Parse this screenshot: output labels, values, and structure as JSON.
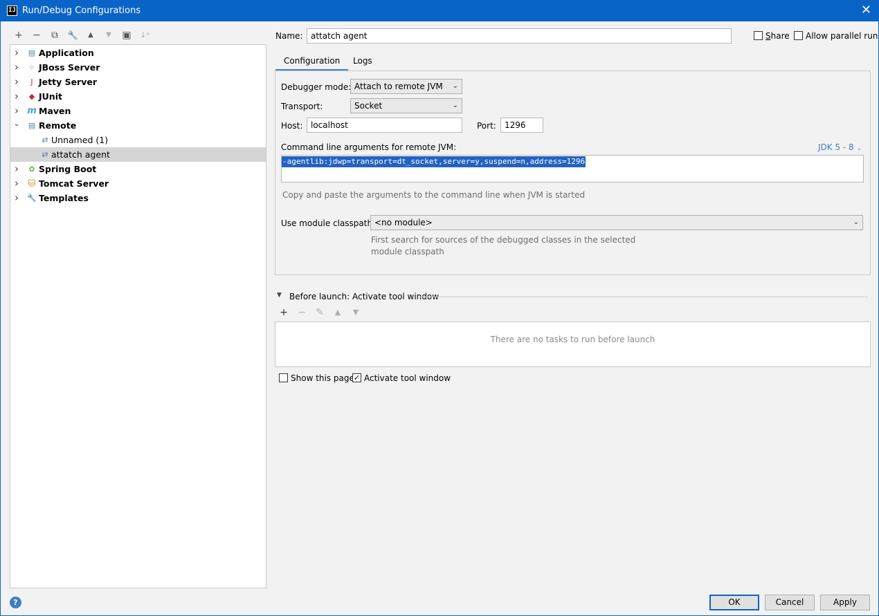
{
  "window": {
    "title": "Run/Debug Configurations",
    "app_icon": "IJ",
    "close_glyph": "✕"
  },
  "left_toolbar": [
    {
      "name": "add-config-button",
      "glyph": "+",
      "enabled": true
    },
    {
      "name": "remove-config-button",
      "glyph": "−",
      "enabled": true
    },
    {
      "name": "copy-config-button",
      "glyph": "⧉",
      "enabled": true
    },
    {
      "name": "edit-defaults-button",
      "glyph": "🔧",
      "enabled": true
    },
    {
      "name": "move-up-button",
      "glyph": "▲",
      "enabled": true
    },
    {
      "name": "move-down-button",
      "glyph": "▼",
      "enabled": false
    },
    {
      "name": "new-folder-button",
      "glyph": "▣",
      "enabled": true
    },
    {
      "name": "sort-button",
      "glyph": "↓ᵃ",
      "enabled": false
    }
  ],
  "tree": [
    {
      "label": "Application",
      "icon": "application-icon",
      "glyph": "▤",
      "color": "#5a7fa6",
      "bold": true,
      "expandable": true,
      "expanded": false
    },
    {
      "label": "JBoss Server",
      "icon": "jboss-icon",
      "glyph": "⁘",
      "color": "#d0282c",
      "bold": true,
      "expandable": true,
      "expanded": false
    },
    {
      "label": "Jetty Server",
      "icon": "jetty-icon",
      "glyph": "J",
      "color": "#d0282c",
      "bold": true,
      "expandable": true,
      "expanded": false
    },
    {
      "label": "JUnit",
      "icon": "junit-icon",
      "glyph": "◆",
      "color": "#d0282c",
      "bold": true,
      "expandable": true,
      "expanded": false
    },
    {
      "label": "Maven",
      "icon": "maven-icon",
      "glyph": "m",
      "color": "#3fa9d6",
      "bold": true,
      "expandable": true,
      "expanded": false
    },
    {
      "label": "Remote",
      "icon": "remote-icon",
      "glyph": "▤",
      "color": "#5a7fa6",
      "bold": true,
      "expandable": true,
      "expanded": true
    },
    {
      "label": "Unnamed (1)",
      "icon": "remote-config-icon",
      "glyph": "⇄",
      "color": "#5a7fa6",
      "bold": false,
      "expandable": false,
      "child": true
    },
    {
      "label": "attatch agent",
      "icon": "remote-config-icon",
      "glyph": "⇄",
      "color": "#5a7fa6",
      "bold": false,
      "expandable": false,
      "child": true,
      "selected": true
    },
    {
      "label": "Spring Boot",
      "icon": "spring-boot-icon",
      "glyph": "✿",
      "color": "#6ab04c",
      "bold": true,
      "expandable": true,
      "expanded": false
    },
    {
      "label": "Tomcat Server",
      "icon": "tomcat-icon",
      "glyph": "🐱",
      "color": "#c98a1d",
      "bold": true,
      "expandable": true,
      "expanded": false
    },
    {
      "label": "Templates",
      "icon": "wrench-icon",
      "glyph": "🔧",
      "color": "#555555",
      "bold": true,
      "expandable": true,
      "expanded": false
    }
  ],
  "name_row": {
    "label": "Name:",
    "value": "attatch agent",
    "share_label": "Share",
    "share_checked": false,
    "parallel_label": "Allow parallel run",
    "parallel_checked": false
  },
  "tabs": [
    {
      "label": "Configuration",
      "active": true
    },
    {
      "label": "Logs",
      "active": false
    }
  ],
  "config": {
    "debugger_mode_label": "Debugger mode:",
    "debugger_mode_value": "Attach to remote JVM",
    "transport_label": "Transport:",
    "transport_value": "Socket",
    "host_label": "Host:",
    "host_value": "localhost",
    "port_label": "Port:",
    "port_value": "1296",
    "args_label": "Command line arguments for remote JVM:",
    "jdk_link": "JDK 5 - 8",
    "args_value": "-agentlib:jdwp=transport=dt_socket,server=y,suspend=n,address=1296",
    "args_hint": "Copy and paste the arguments to the command line when JVM is started",
    "module_label": "Use module classpath:",
    "module_value": "<no module>",
    "module_hint_1": "First search for sources of the debugged classes in the selected",
    "module_hint_2": "module classpath"
  },
  "before_launch": {
    "title": "Before launch: Activate tool window",
    "empty_text": "There are no tasks to run before launch",
    "show_page_label": "Show this page",
    "show_page_checked": false,
    "activate_label": "Activate tool window",
    "activate_checked": true
  },
  "buttons": {
    "ok": "OK",
    "cancel": "Cancel",
    "apply": "Apply",
    "help": "?"
  },
  "colors": {
    "accent": "#0a64c8",
    "selection": "#2462c2",
    "link": "#3c7fc4"
  }
}
